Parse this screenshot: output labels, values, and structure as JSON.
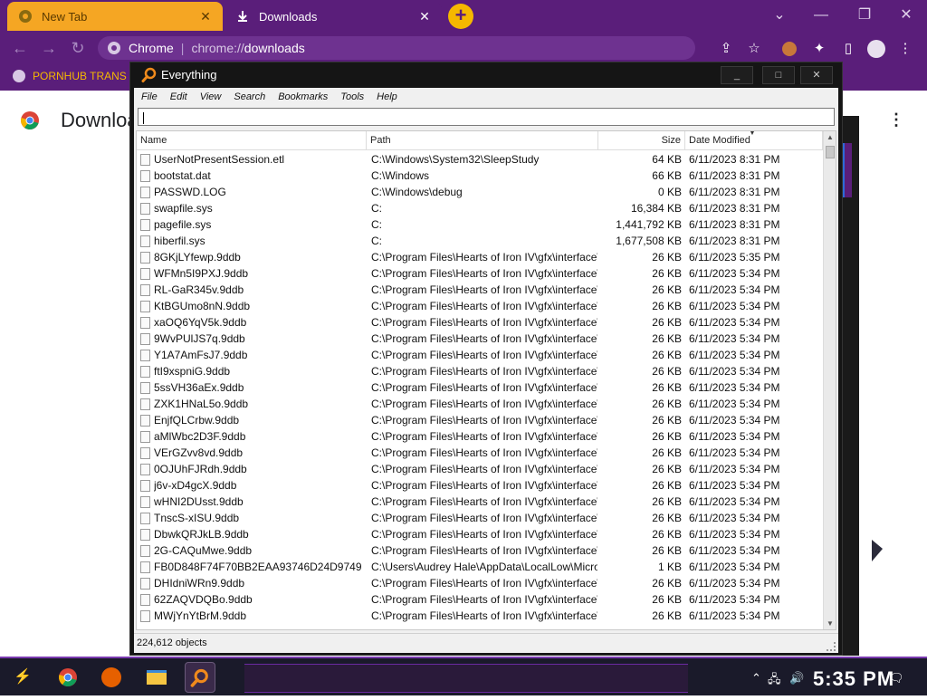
{
  "browser": {
    "tabs": [
      {
        "label": "New Tab"
      },
      {
        "label": "Downloads"
      }
    ],
    "close_glyph": "✕",
    "newtab_glyph": "+",
    "omnibox": {
      "site": "Chrome",
      "url_prefix": "chrome://",
      "url_path": "downloads"
    },
    "bookmark": {
      "label": "PORNHUB TRANS"
    },
    "page_title": "Downloads",
    "accent_color": "#5a1e7a",
    "tab_color": "#f5a623"
  },
  "everything": {
    "title": "Everything",
    "menu": [
      "File",
      "Edit",
      "View",
      "Search",
      "Bookmarks",
      "Tools",
      "Help"
    ],
    "search_value": "",
    "columns": {
      "name": "Name",
      "path": "Path",
      "size": "Size",
      "date": "Date Modified"
    },
    "rows": [
      {
        "name": "UserNotPresentSession.etl",
        "path": "C:\\Windows\\System32\\SleepStudy",
        "size": "64 KB",
        "date": "6/11/2023 8:31 PM"
      },
      {
        "name": "bootstat.dat",
        "path": "C:\\Windows",
        "size": "66 KB",
        "date": "6/11/2023 8:31 PM"
      },
      {
        "name": "PASSWD.LOG",
        "path": "C:\\Windows\\debug",
        "size": "0 KB",
        "date": "6/11/2023 8:31 PM"
      },
      {
        "name": "swapfile.sys",
        "path": "C:",
        "size": "16,384 KB",
        "date": "6/11/2023 8:31 PM"
      },
      {
        "name": "pagefile.sys",
        "path": "C:",
        "size": "1,441,792 KB",
        "date": "6/11/2023 8:31 PM"
      },
      {
        "name": "hiberfil.sys",
        "path": "C:",
        "size": "1,677,508 KB",
        "date": "6/11/2023 8:31 PM"
      },
      {
        "name": "8GKjLYfewp.9ddb",
        "path": "C:\\Program Files\\Hearts of Iron IV\\gfx\\interface\\...",
        "size": "26 KB",
        "date": "6/11/2023 5:35 PM"
      },
      {
        "name": "WFMn5I9PXJ.9ddb",
        "path": "C:\\Program Files\\Hearts of Iron IV\\gfx\\interface\\...",
        "size": "26 KB",
        "date": "6/11/2023 5:34 PM"
      },
      {
        "name": "RL-GaR345v.9ddb",
        "path": "C:\\Program Files\\Hearts of Iron IV\\gfx\\interface\\...",
        "size": "26 KB",
        "date": "6/11/2023 5:34 PM"
      },
      {
        "name": "KtBGUmo8nN.9ddb",
        "path": "C:\\Program Files\\Hearts of Iron IV\\gfx\\interface\\...",
        "size": "26 KB",
        "date": "6/11/2023 5:34 PM"
      },
      {
        "name": "xaOQ6YqV5k.9ddb",
        "path": "C:\\Program Files\\Hearts of Iron IV\\gfx\\interface\\...",
        "size": "26 KB",
        "date": "6/11/2023 5:34 PM"
      },
      {
        "name": "9WvPUlJS7q.9ddb",
        "path": "C:\\Program Files\\Hearts of Iron IV\\gfx\\interface\\...",
        "size": "26 KB",
        "date": "6/11/2023 5:34 PM"
      },
      {
        "name": "Y1A7AmFsJ7.9ddb",
        "path": "C:\\Program Files\\Hearts of Iron IV\\gfx\\interface\\...",
        "size": "26 KB",
        "date": "6/11/2023 5:34 PM"
      },
      {
        "name": "ftI9xspniG.9ddb",
        "path": "C:\\Program Files\\Hearts of Iron IV\\gfx\\interface\\...",
        "size": "26 KB",
        "date": "6/11/2023 5:34 PM"
      },
      {
        "name": "5ssVH36aEx.9ddb",
        "path": "C:\\Program Files\\Hearts of Iron IV\\gfx\\interface\\...",
        "size": "26 KB",
        "date": "6/11/2023 5:34 PM"
      },
      {
        "name": "ZXK1HNaL5o.9ddb",
        "path": "C:\\Program Files\\Hearts of Iron IV\\gfx\\interface\\...",
        "size": "26 KB",
        "date": "6/11/2023 5:34 PM"
      },
      {
        "name": "EnjfQLCrbw.9ddb",
        "path": "C:\\Program Files\\Hearts of Iron IV\\gfx\\interface\\...",
        "size": "26 KB",
        "date": "6/11/2023 5:34 PM"
      },
      {
        "name": "aMlWbc2D3F.9ddb",
        "path": "C:\\Program Files\\Hearts of Iron IV\\gfx\\interface\\...",
        "size": "26 KB",
        "date": "6/11/2023 5:34 PM"
      },
      {
        "name": "VErGZvv8vd.9ddb",
        "path": "C:\\Program Files\\Hearts of Iron IV\\gfx\\interface\\...",
        "size": "26 KB",
        "date": "6/11/2023 5:34 PM"
      },
      {
        "name": "0OJUhFJRdh.9ddb",
        "path": "C:\\Program Files\\Hearts of Iron IV\\gfx\\interface\\...",
        "size": "26 KB",
        "date": "6/11/2023 5:34 PM"
      },
      {
        "name": "j6v-xD4gcX.9ddb",
        "path": "C:\\Program Files\\Hearts of Iron IV\\gfx\\interface\\...",
        "size": "26 KB",
        "date": "6/11/2023 5:34 PM"
      },
      {
        "name": "wHNI2DUsst.9ddb",
        "path": "C:\\Program Files\\Hearts of Iron IV\\gfx\\interface\\...",
        "size": "26 KB",
        "date": "6/11/2023 5:34 PM"
      },
      {
        "name": "TnscS-xISU.9ddb",
        "path": "C:\\Program Files\\Hearts of Iron IV\\gfx\\interface\\...",
        "size": "26 KB",
        "date": "6/11/2023 5:34 PM"
      },
      {
        "name": "DbwkQRJkLB.9ddb",
        "path": "C:\\Program Files\\Hearts of Iron IV\\gfx\\interface\\...",
        "size": "26 KB",
        "date": "6/11/2023 5:34 PM"
      },
      {
        "name": "2G-CAQuMwe.9ddb",
        "path": "C:\\Program Files\\Hearts of Iron IV\\gfx\\interface\\...",
        "size": "26 KB",
        "date": "6/11/2023 5:34 PM"
      },
      {
        "name": "FB0D848F74F70BB2EAA93746D24D9749",
        "path": "C:\\Users\\Audrey Hale\\AppData\\LocalLow\\Micros...",
        "size": "1 KB",
        "date": "6/11/2023 5:34 PM"
      },
      {
        "name": "DHIdniWRn9.9ddb",
        "path": "C:\\Program Files\\Hearts of Iron IV\\gfx\\interface\\...",
        "size": "26 KB",
        "date": "6/11/2023 5:34 PM"
      },
      {
        "name": "62ZAQVDQBo.9ddb",
        "path": "C:\\Program Files\\Hearts of Iron IV\\gfx\\interface\\...",
        "size": "26 KB",
        "date": "6/11/2023 5:34 PM"
      },
      {
        "name": "MWjYnYtBrM.9ddb",
        "path": "C:\\Program Files\\Hearts of Iron IV\\gfx\\interface\\...",
        "size": "26 KB",
        "date": "6/11/2023 5:34 PM"
      }
    ],
    "status": "224,612 objects"
  },
  "taskbar": {
    "clock": "5:35 PM"
  },
  "icons": {
    "chrome": "chrome-icon",
    "everything": "everything-magnifier-icon",
    "close": "close-icon",
    "minimize": "minimize-icon",
    "maximize": "maximize-icon"
  }
}
